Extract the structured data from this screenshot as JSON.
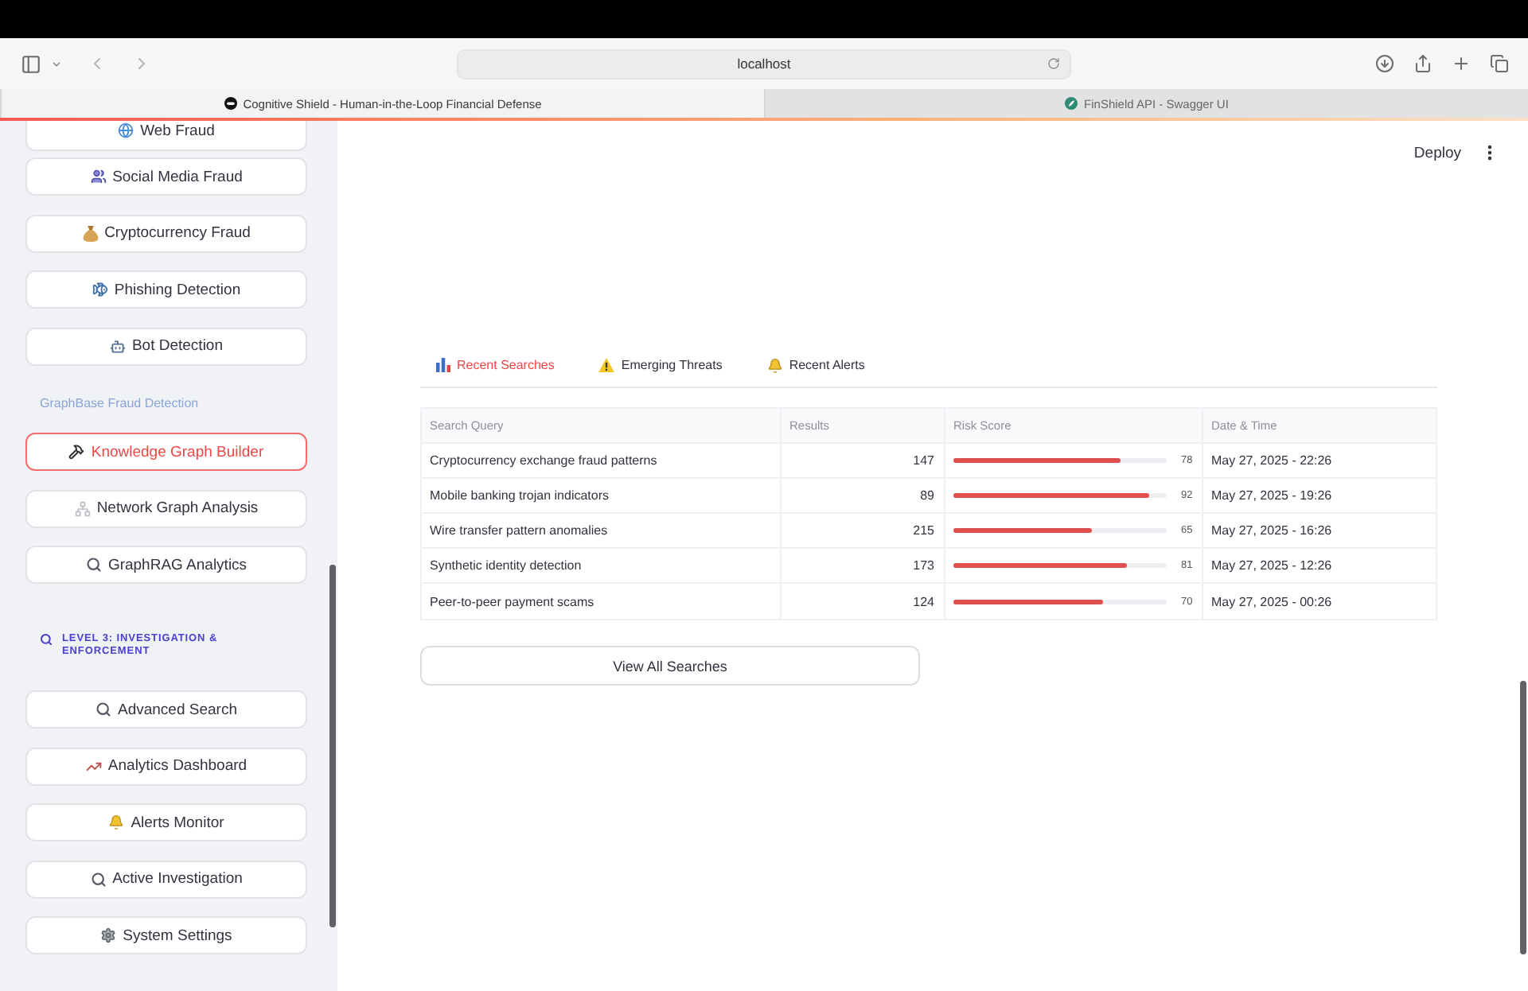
{
  "browser": {
    "address": "localhost",
    "tabs": [
      {
        "title": "Cognitive Shield - Human-in-the-Loop Financial Defense",
        "selected": true
      },
      {
        "title": "FinShield API - Swagger UI",
        "selected": false
      }
    ]
  },
  "sidebar": {
    "items": [
      {
        "kind": "button",
        "label": "Web Fraud",
        "selected": false
      },
      {
        "kind": "button",
        "label": "Social Media Fraud",
        "selected": false
      },
      {
        "kind": "button",
        "label": "Cryptocurrency Fraud",
        "selected": false
      },
      {
        "kind": "button",
        "label": "Phishing Detection",
        "selected": false
      },
      {
        "kind": "button",
        "label": "Bot Detection",
        "selected": false
      },
      {
        "kind": "caption",
        "label": "GraphBase Fraud Detection"
      },
      {
        "kind": "button",
        "label": "Knowledge Graph Builder",
        "selected": true
      },
      {
        "kind": "button",
        "label": "Network Graph Analysis",
        "selected": false
      },
      {
        "kind": "button",
        "label": "GraphRAG Analytics",
        "selected": false
      },
      {
        "kind": "heading",
        "label": "LEVEL 3: INVESTIGATION & ENFORCEMENT"
      },
      {
        "kind": "button",
        "label": "Advanced Search",
        "selected": false
      },
      {
        "kind": "button",
        "label": "Analytics Dashboard",
        "selected": false
      },
      {
        "kind": "button",
        "label": "Alerts Monitor",
        "selected": false
      },
      {
        "kind": "button",
        "label": "Active Investigation",
        "selected": false
      },
      {
        "kind": "button",
        "label": "System Settings",
        "selected": false
      }
    ]
  },
  "header": {
    "deploy": "Deploy"
  },
  "tabs": [
    {
      "label": "Recent Searches",
      "selected": true
    },
    {
      "label": "Emerging Threats",
      "selected": false
    },
    {
      "label": "Recent Alerts",
      "selected": false
    }
  ],
  "table": {
    "columns": [
      "Search Query",
      "Results",
      "Risk Score",
      "Date & Time"
    ],
    "rows": [
      {
        "query": "Cryptocurrency exchange fraud patterns",
        "results": "147",
        "risk": {
          "level": 0.78,
          "reading": "78"
        },
        "date": "May 27, 2025 - 22:26"
      },
      {
        "query": "Mobile banking trojan indicators",
        "results": "89",
        "risk": {
          "level": 0.92,
          "reading": "92"
        },
        "date": "May 27, 2025 - 19:26"
      },
      {
        "query": "Wire transfer pattern anomalies",
        "results": "215",
        "risk": {
          "level": 0.65,
          "reading": "65"
        },
        "date": "May 27, 2025 - 16:26"
      },
      {
        "query": "Synthetic identity detection",
        "results": "173",
        "risk": {
          "level": 0.81,
          "reading": "81"
        },
        "date": "May 27, 2025 - 12:26"
      },
      {
        "query": "Peer-to-peer payment scams",
        "results": "124",
        "risk": {
          "level": 0.7,
          "reading": "70"
        },
        "date": "May 27, 2025 - 00:26"
      }
    ]
  },
  "view_all": {
    "label": "View All Searches"
  }
}
